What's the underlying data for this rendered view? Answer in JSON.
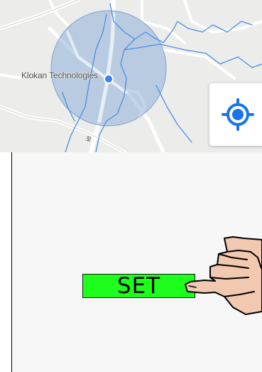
{
  "map": {
    "place_label": "Klokan Technologies",
    "road_label": "ie",
    "accuracy_circle_color": "#8fb0d8",
    "location_dot_color": "#3b82f6",
    "water_color": "#4a90e2",
    "locate_button_icon": "my-location-icon",
    "locate_button_color": "#1a73e8"
  },
  "panel": {
    "set_button_label": "SET",
    "set_button_color": "#1dfe1d",
    "pointer_icon": "pointing-hand-icon"
  }
}
